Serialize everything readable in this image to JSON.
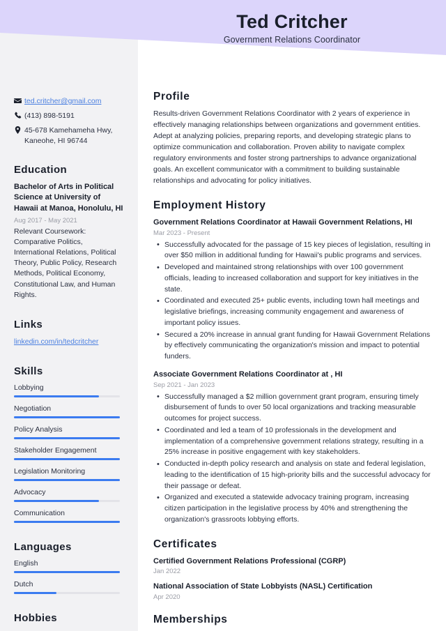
{
  "theme": {
    "header_bg": "#DCD5FB",
    "sidebar_bg": "#F2F2F4",
    "accent_bar": "#3B7BF0",
    "bar_track": "#E3E3E8",
    "link_color": "#4A7FE0",
    "text_color": "#2B3040",
    "heading_color": "#1A1F2B",
    "muted_color": "#9A9CA5"
  },
  "header": {
    "name": "Ted Critcher",
    "job_title": "Government Relations Coordinator"
  },
  "sidebar": {
    "contact": [
      {
        "icon": "envelope-icon",
        "text": "ted.critcher@gmail.com",
        "is_link": true
      },
      {
        "icon": "phone-icon",
        "text": "(413) 898-5191",
        "is_link": false
      },
      {
        "icon": "location-pin-icon",
        "text": "45-678 Kamehameha Hwy, Kaneohe, HI 96744",
        "is_link": false
      }
    ],
    "education": {
      "heading": "Education",
      "degree": "Bachelor of Arts in Political Science at University of Hawaii at Manoa, Honolulu, HI",
      "date": "Aug 2017 - May 2021",
      "description": "Relevant Coursework: Comparative Politics, International Relations, Political Theory, Public Policy, Research Methods, Political Economy, Constitutional Law, and Human Rights."
    },
    "links": {
      "heading": "Links",
      "items": [
        {
          "label": "linkedin.com/in/tedcritcher"
        }
      ]
    },
    "skills": {
      "heading": "Skills",
      "items": [
        {
          "label": "Lobbying",
          "level": 80
        },
        {
          "label": "Negotiation",
          "level": 100
        },
        {
          "label": "Policy Analysis",
          "level": 100
        },
        {
          "label": "Stakeholder Engagement",
          "level": 100
        },
        {
          "label": "Legislation Monitoring",
          "level": 100
        },
        {
          "label": "Advocacy",
          "level": 80
        },
        {
          "label": "Communication",
          "level": 100
        }
      ]
    },
    "languages": {
      "heading": "Languages",
      "items": [
        {
          "label": "English",
          "level": 100
        },
        {
          "label": "Dutch",
          "level": 40
        }
      ]
    },
    "hobbies": {
      "heading": "Hobbies"
    }
  },
  "main": {
    "profile": {
      "heading": "Profile",
      "text": "Results-driven Government Relations Coordinator with 2 years of experience in effectively managing relationships between organizations and government entities. Adept at analyzing policies, preparing reports, and developing strategic plans to optimize communication and collaboration. Proven ability to navigate complex regulatory environments and foster strong partnerships to advance organizational goals. An excellent communicator with a commitment to building sustainable relationships and advocating for policy initiatives."
    },
    "employment": {
      "heading": "Employment History",
      "jobs": [
        {
          "title": "Government Relations Coordinator at Hawaii Government Relations, HI",
          "date": "Mar 2023 - Present",
          "bullets": [
            "Successfully advocated for the passage of 15 key pieces of legislation, resulting in over $50 million in additional funding for Hawaii's public programs and services.",
            "Developed and maintained strong relationships with over 100 government officials, leading to increased collaboration and support for key initiatives in the state.",
            "Coordinated and executed 25+ public events, including town hall meetings and legislative briefings, increasing community engagement and awareness of important policy issues.",
            "Secured a 20% increase in annual grant funding for Hawaii Government Relations by effectively communicating the organization's mission and impact to potential funders."
          ]
        },
        {
          "title": "Associate Government Relations Coordinator at , HI",
          "date": "Sep 2021 - Jan 2023",
          "bullets": [
            "Successfully managed a $2 million government grant program, ensuring timely disbursement of funds to over 50 local organizations and tracking measurable outcomes for project success.",
            "Coordinated and led a team of 10 professionals in the development and implementation of a comprehensive government relations strategy, resulting in a 25% increase in positive engagement with key stakeholders.",
            "Conducted in-depth policy research and analysis on state and federal legislation, leading to the identification of 15 high-priority bills and the successful advocacy for their passage or defeat.",
            "Organized and executed a statewide advocacy training program, increasing citizen participation in the legislative process by 40% and strengthening the organization's grassroots lobbying efforts."
          ]
        }
      ]
    },
    "certificates": {
      "heading": "Certificates",
      "items": [
        {
          "title": "Certified Government Relations Professional (CGRP)",
          "date": "Jan 2022"
        },
        {
          "title": "National Association of State Lobbyists (NASL) Certification",
          "date": "Apr 2020"
        }
      ]
    },
    "memberships": {
      "heading": "Memberships"
    }
  }
}
